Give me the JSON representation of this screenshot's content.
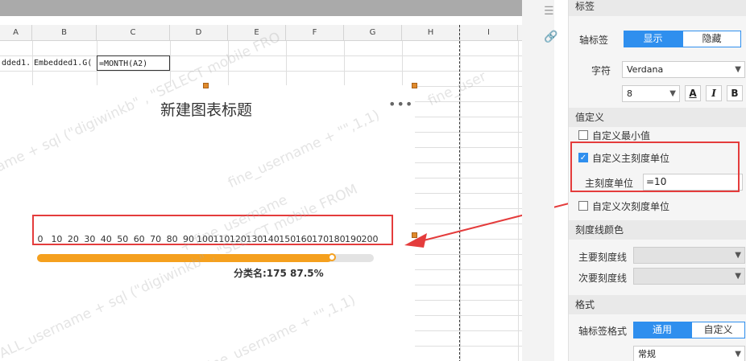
{
  "spreadsheet": {
    "columns": [
      "A",
      "B",
      "C",
      "D",
      "E",
      "F",
      "G",
      "H",
      "I"
    ],
    "cells": {
      "a2": "dded1.",
      "b2": "Embedded1.G(",
      "c2": "=MONTH(A2)"
    },
    "watermarks": [
      "ame + sql (\"digiwinkb\" , \"SELECT mobile FRO",
      "+ fine_username",
      "fine_user",
      "fine_username + \"\",1,1)",
      "ALL_username + sql (\"digiwinkb\" , \"SELECT mobile FROM",
      "fine_username + \"\",1,1)"
    ]
  },
  "chart": {
    "title": "新建图表标题",
    "more_icon": "ellipsis-icon",
    "category_label": "分类名:175 87.5%",
    "chart_data": {
      "type": "gauge",
      "title": "新建图表标题",
      "ticks": [
        "0",
        "10",
        "20",
        "30",
        "40",
        "50",
        "60",
        "70",
        "80",
        "90",
        "100",
        "110",
        "120",
        "130",
        "140",
        "150",
        "160",
        "170",
        "180",
        "190",
        "200"
      ],
      "min": 0,
      "max": 200,
      "value": 175,
      "percent_label": "87.5%",
      "category": "分类名",
      "colors": {
        "fill": "#f5a01e",
        "track": "#e3e3e3"
      }
    }
  },
  "sidebar_icons": [
    "layout-icon",
    "link-icon"
  ],
  "panel": {
    "top_section": "标签",
    "axis_label": {
      "label": "轴标签",
      "show": "显示",
      "hide": "隐藏"
    },
    "font": {
      "label": "字符",
      "family": "Verdana",
      "size": "8",
      "color_btn": "A",
      "italic_btn": "I",
      "bold_btn": "B"
    },
    "value_def_section": "值定义",
    "custom_min": {
      "label": "自定义最小值",
      "checked": false
    },
    "custom_major": {
      "label": "自定义主刻度单位",
      "checked": true
    },
    "major_unit": {
      "label": "主刻度单位",
      "value": "=10"
    },
    "custom_minor": {
      "label": "自定义次刻度单位",
      "checked": false
    },
    "tick_color_section": "刻度线颜色",
    "major_tick": {
      "label": "主要刻度线"
    },
    "minor_tick": {
      "label": "次要刻度线"
    },
    "format_section": "格式",
    "axis_label_format": {
      "label": "轴标签格式",
      "general": "通用",
      "custom": "自定义"
    },
    "format_value": "常规"
  },
  "colors": {
    "accent": "#2f8fee",
    "highlight": "#e43c3c",
    "gauge": "#f5a01e"
  }
}
